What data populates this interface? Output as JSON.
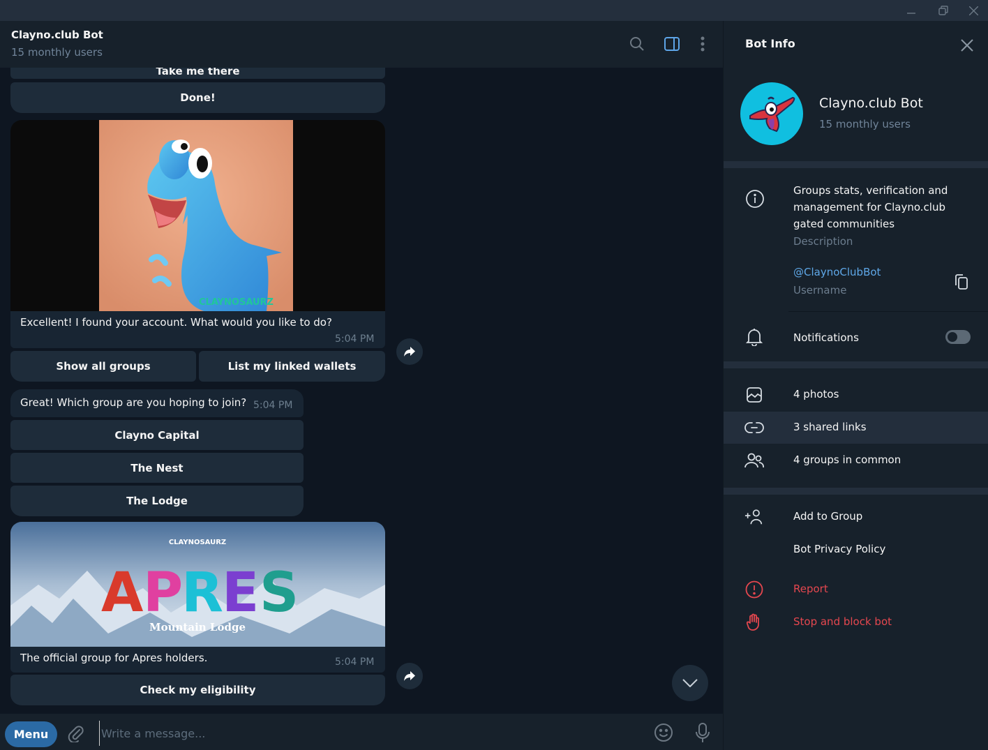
{
  "window": {
    "controls": [
      "minimize",
      "restore",
      "close"
    ]
  },
  "chat": {
    "title": "Clayno.club Bot",
    "subtitle": "15 monthly users",
    "header_icons": [
      "search-icon",
      "sidebar-toggle-icon",
      "more-vertical-icon"
    ],
    "partial_button": "Take me there",
    "done_button": "Done!",
    "messages": [
      {
        "image": "claynosaurz-blue-dino",
        "image_watermark": "CLAYNOSAURZ",
        "text": "Excellent! I found your account. What would you like to do?",
        "time": "5:04 PM",
        "buttons": [
          "Show all groups",
          "List my linked wallets"
        ]
      },
      {
        "text": "Great! Which group are you hoping to join?",
        "time": "5:04 PM",
        "buttons": [
          "Clayno Capital",
          "The Nest",
          "The Lodge"
        ]
      },
      {
        "image": "apres-mountain-lodge-banner",
        "image_title": "APRES",
        "image_subtitle": "Mountain Lodge",
        "image_brand": "CLAYNOSAURZ",
        "text": "The official group for Apres holders.",
        "time": "5:04 PM",
        "buttons": [
          "Check my eligibility"
        ]
      }
    ]
  },
  "composer": {
    "menu_label": "Menu",
    "placeholder": "Write a message..."
  },
  "panel": {
    "title": "Bot Info",
    "name": "Clayno.club Bot",
    "subtitle": "15 monthly users",
    "description": "Groups stats, verification and management for Clayno.club gated communities",
    "description_caption": "Description",
    "username": "@ClaynoClubBot",
    "username_caption": "Username",
    "notifications_label": "Notifications",
    "notifications_on": false,
    "media": [
      {
        "label": "4 photos",
        "icon": "photo-icon"
      },
      {
        "label": "3 shared links",
        "icon": "link-icon"
      },
      {
        "label": "4 groups in common",
        "icon": "groups-icon"
      }
    ],
    "actions": [
      {
        "label": "Add to Group",
        "icon": "add-user-icon"
      },
      {
        "label": "Bot Privacy Policy",
        "icon": ""
      },
      {
        "label": "Report",
        "icon": "report-icon"
      },
      {
        "label": "Stop and block bot",
        "icon": "hand-stop-icon"
      }
    ]
  },
  "colors": {
    "accent": "#2b6aa5",
    "link": "#5fa8e8",
    "danger": "#e5474f",
    "bg_chat": "#0e1621",
    "bg_panel": "#17212b"
  }
}
